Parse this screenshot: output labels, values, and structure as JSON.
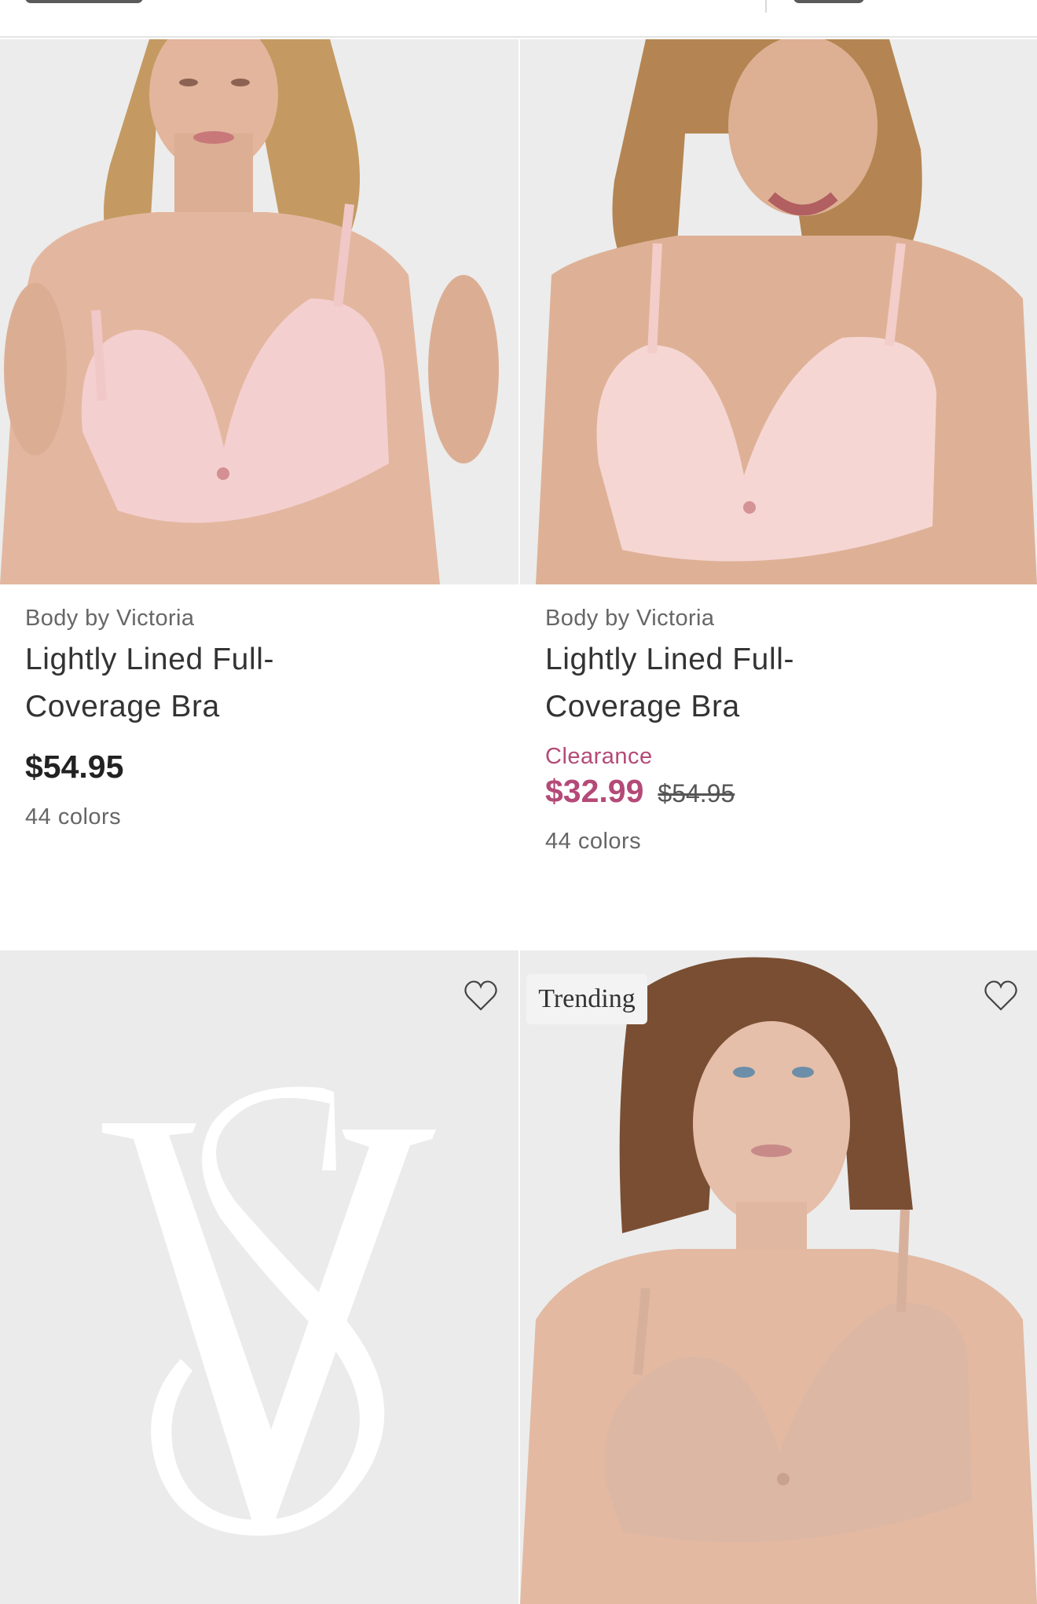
{
  "products": [
    {
      "brand": "Body by Victoria",
      "title": "Lightly Lined Full-Coverage Bra",
      "price": "$54.95",
      "colors": "44 colors",
      "swatch": "#f4cfcf"
    },
    {
      "brand": "Body by Victoria",
      "title": "Lightly Lined Full-Coverage Bra",
      "clearance_label": "Clearance",
      "sale_price": "$32.99",
      "original_price": "$54.95",
      "colors": "44 colors",
      "swatch": "#f5d6d3"
    }
  ],
  "placeholder_logo": "VS",
  "badges": {
    "trending": "Trending"
  },
  "icons": {
    "favorite": "heart-outline-icon"
  },
  "colors": {
    "clearance": "#b44a78",
    "image_bg": "#ebebeb"
  }
}
